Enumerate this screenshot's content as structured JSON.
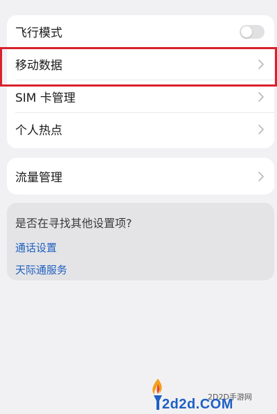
{
  "card1": {
    "rows": [
      {
        "label": "飞行模式",
        "control": "toggle",
        "toggle_on": false
      },
      {
        "label": "移动数据",
        "control": "chevron-right-icon"
      },
      {
        "label": "SIM 卡管理",
        "control": "chevron-right-icon"
      },
      {
        "label": "个人热点",
        "control": "chevron-right-icon"
      }
    ]
  },
  "card2": {
    "rows": [
      {
        "label": "流量管理",
        "control": "chevron-right-icon"
      }
    ]
  },
  "suggestions": {
    "title": "是否在寻找其他设置项?",
    "links": [
      "通话设置",
      "天际通服务"
    ]
  },
  "highlight": {
    "target": "移动数据",
    "color": "#d9202c"
  },
  "watermark": {
    "site": "2D2D手游网",
    "domain": "2d2d.COM"
  },
  "colors": {
    "background": "#f1f1f3",
    "link": "#1f5fbf",
    "highlight": "#d9202c"
  }
}
